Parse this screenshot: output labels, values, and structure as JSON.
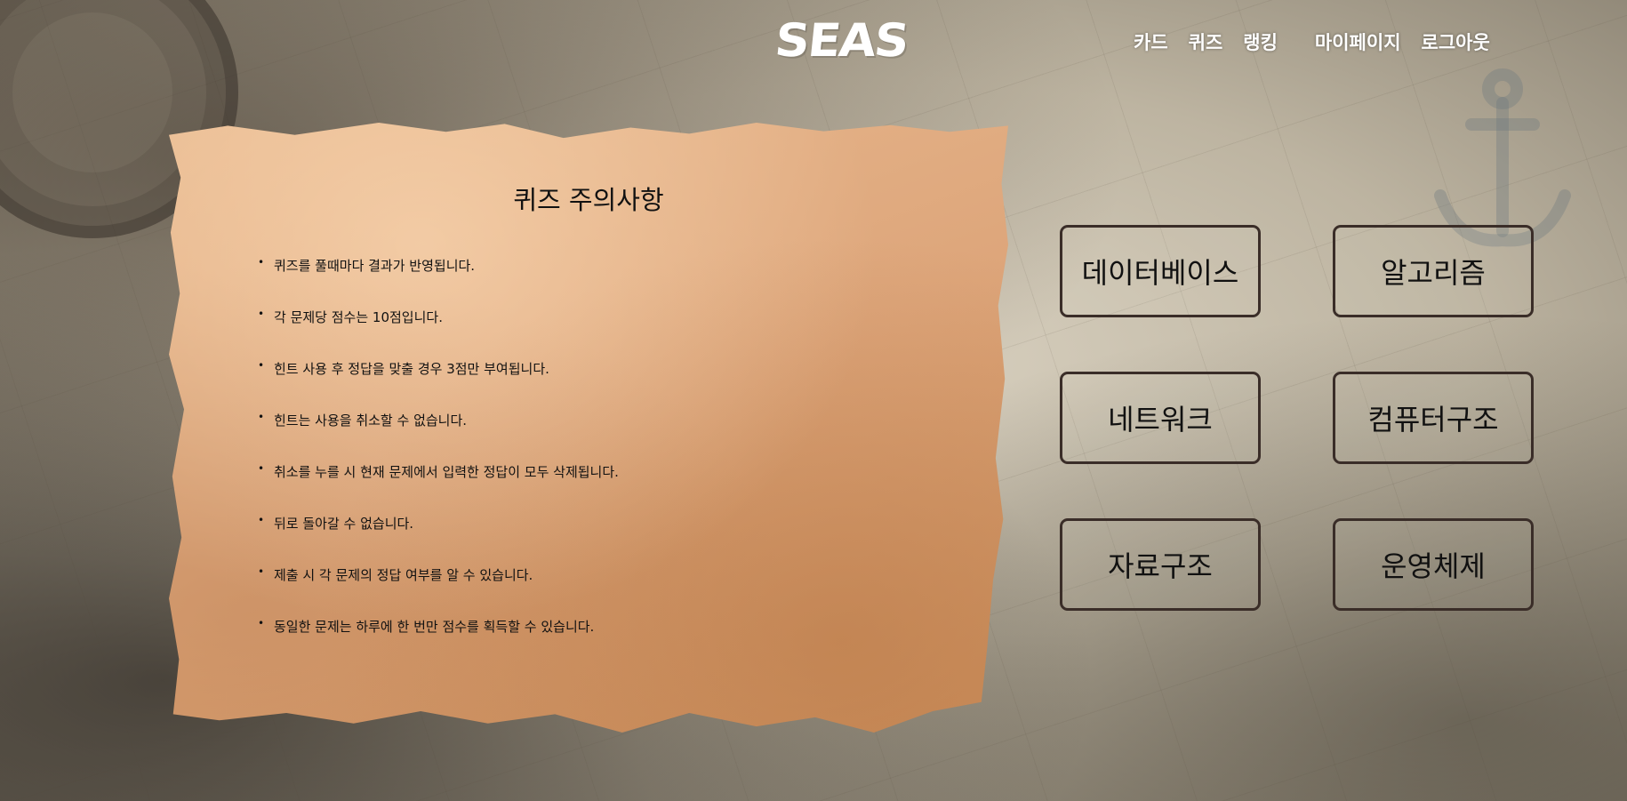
{
  "header": {
    "logo_text": "SEAS",
    "nav": [
      {
        "label": "카드"
      },
      {
        "label": "퀴즈"
      },
      {
        "label": "랭킹"
      },
      {
        "label": "마이페이지"
      },
      {
        "label": "로그아웃"
      }
    ]
  },
  "notice": {
    "title": "퀴즈 주의사항",
    "rules": [
      "퀴즈를 풀때마다 결과가 반영됩니다.",
      "각 문제당 점수는 10점입니다.",
      "힌트 사용 후 정답을 맞출 경우 3점만 부여됩니다.",
      "힌트는 사용을 취소할 수 없습니다.",
      "취소를 누를 시 현재 문제에서 입력한 정답이 모두 삭제됩니다.",
      "뒤로 돌아갈 수 없습니다.",
      "제출 시 각 문제의 정답 여부를 알 수 있습니다.",
      "동일한 문제는 하루에 한 번만 점수를 획득할 수 있습니다."
    ]
  },
  "categories": [
    {
      "label": "데이터베이스"
    },
    {
      "label": "알고리즘"
    },
    {
      "label": "네트워크"
    },
    {
      "label": "컴퓨터구조"
    },
    {
      "label": "자료구조"
    },
    {
      "label": "운영체제"
    }
  ],
  "colors": {
    "parchment": "#dda57a",
    "button_border": "#3a2d28",
    "nav_text": "#ffffff"
  }
}
